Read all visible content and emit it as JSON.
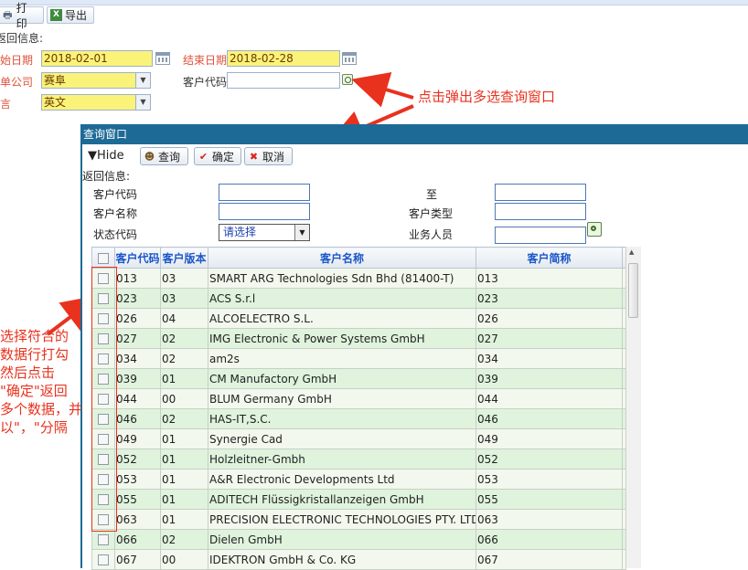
{
  "toolbar": {
    "print_label": "打印",
    "export_label": "导出"
  },
  "form": {
    "return_info_label": "返回信息:",
    "start_date_label": "起始日期",
    "start_date_value": "2018-02-01",
    "end_date_label": "结束日期",
    "end_date_value": "2018-02-28",
    "company_label": "接单公司",
    "company_value": "赛阜",
    "customer_code_label": "客户代码",
    "customer_code_value": "",
    "language_label": "语言",
    "language_value": "英文"
  },
  "annotations": {
    "popup_hint": "点击弹出多选查询窗口",
    "select_hint_lines": [
      "选择符合的",
      "数据行打勾",
      "然后点击",
      "\"确定\"返回",
      "多个数据，并",
      "以\"，\"分隔"
    ]
  },
  "dialog": {
    "title": "查询窗口",
    "hide_label": "▼Hide",
    "query_label": "查询",
    "ok_label": "确定",
    "cancel_label": "取消",
    "return_info_label": "返回信息:",
    "fields": {
      "customer_code_label": "客户代码",
      "to_label": "至",
      "customer_name_label": "客户名称",
      "customer_type_label": "客户类型",
      "status_code_label": "状态代码",
      "status_select_value": "请选择",
      "salesperson_label": "业务人员"
    },
    "columns": [
      "客户代码",
      "客户版本",
      "客户名称",
      "客户简称"
    ],
    "rows": [
      {
        "code": "013",
        "ver": "03",
        "name": "SMART ARG Technologies Sdn Bhd (81400-T)",
        "short": "013"
      },
      {
        "code": "023",
        "ver": "03",
        "name": "ACS S.r.l",
        "short": "023"
      },
      {
        "code": "026",
        "ver": "04",
        "name": "ALCOELECTRO S.L.",
        "short": "026"
      },
      {
        "code": "027",
        "ver": "02",
        "name": "IMG Electronic & Power Systems GmbH",
        "short": "027"
      },
      {
        "code": "034",
        "ver": "02",
        "name": "am2s",
        "short": "034"
      },
      {
        "code": "039",
        "ver": "01",
        "name": "CM Manufactory GmbH",
        "short": "039"
      },
      {
        "code": "044",
        "ver": "00",
        "name": "BLUM Germany GmbH",
        "short": "044"
      },
      {
        "code": "046",
        "ver": "02",
        "name": "HAS-IT,S.C.",
        "short": "046"
      },
      {
        "code": "049",
        "ver": "01",
        "name": "Synergie Cad",
        "short": "049"
      },
      {
        "code": "052",
        "ver": "01",
        "name": "Holzleitner-Gmbh",
        "short": "052"
      },
      {
        "code": "053",
        "ver": "01",
        "name": "A&R Electronic Developments Ltd",
        "short": "053"
      },
      {
        "code": "055",
        "ver": "01",
        "name": "ADITECH Flüssigkristallanzeigen GmbH",
        "short": "055"
      },
      {
        "code": "063",
        "ver": "01",
        "name": "PRECISION ELECTRONIC TECHNOLOGIES PTY. LTD",
        "short": "063"
      },
      {
        "code": "066",
        "ver": "02",
        "name": "Dielen GmbH",
        "short": "066"
      },
      {
        "code": "067",
        "ver": "00",
        "name": "IDEKTRON GmbH & Co. KG",
        "short": "067"
      }
    ]
  },
  "colors": {
    "dialog_title_bg": "#1d6a96",
    "header_text": "#1b56c8",
    "required_label": "#e0503a",
    "annotation": "#e8321e",
    "row_even": "#f2f8ed",
    "row_odd": "#dff3dd",
    "yellow_input": "#fbf27a"
  },
  "icons": {
    "print": "printer-icon",
    "export": "excel-icon",
    "query": "people-search-icon",
    "ok": "checkmark-icon",
    "cancel": "x-icon",
    "lookup": "lookup-icon",
    "calendar": "calendar-icon"
  }
}
